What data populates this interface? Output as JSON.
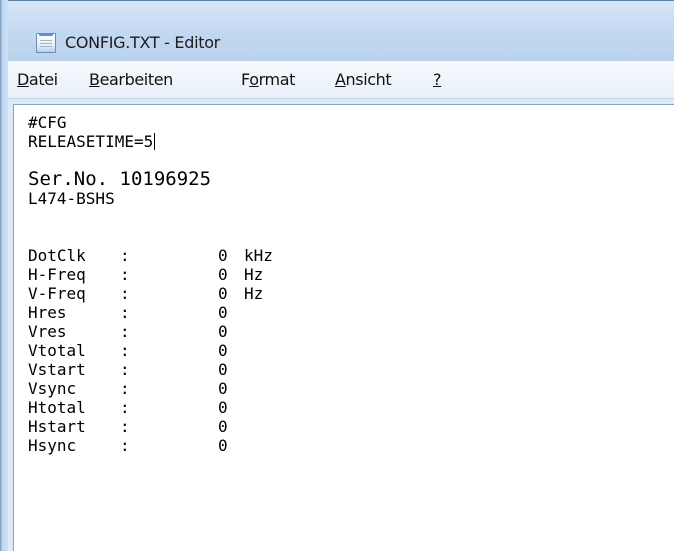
{
  "window": {
    "title": "CONFIG.TXT - Editor"
  },
  "menu": {
    "items": [
      {
        "acc": "D",
        "rest": "atei"
      },
      {
        "acc": "B",
        "rest": "earbeiten"
      },
      {
        "pre": "F",
        "acc": "o",
        "rest": "rmat"
      },
      {
        "acc": "A",
        "rest": "nsicht"
      },
      {
        "acc": "?",
        "rest": ""
      }
    ]
  },
  "editor": {
    "header_lines": [
      "#CFG",
      "RELEASETIME=5"
    ],
    "serial_lines": [
      "Ser.No. 10196925",
      "L474-BSHS"
    ],
    "params": [
      {
        "key": "DotClk",
        "sep": ":",
        "value": "0",
        "unit": "kHz"
      },
      {
        "key": "H-Freq",
        "sep": ":",
        "value": "0",
        "unit": "Hz"
      },
      {
        "key": "V-Freq",
        "sep": ":",
        "value": "0",
        "unit": "Hz"
      },
      {
        "key": "Hres",
        "sep": ":",
        "value": "0",
        "unit": ""
      },
      {
        "key": "Vres",
        "sep": ":",
        "value": "0",
        "unit": ""
      },
      {
        "key": "Vtotal",
        "sep": ":",
        "value": "0",
        "unit": ""
      },
      {
        "key": "Vstart",
        "sep": ":",
        "value": "0",
        "unit": ""
      },
      {
        "key": "Vsync",
        "sep": ":",
        "value": "0",
        "unit": ""
      },
      {
        "key": "Htotal",
        "sep": ":",
        "value": "0",
        "unit": ""
      },
      {
        "key": "Hstart",
        "sep": ":",
        "value": "0",
        "unit": ""
      },
      {
        "key": "Hsync",
        "sep": ":",
        "value": "0",
        "unit": ""
      }
    ]
  }
}
